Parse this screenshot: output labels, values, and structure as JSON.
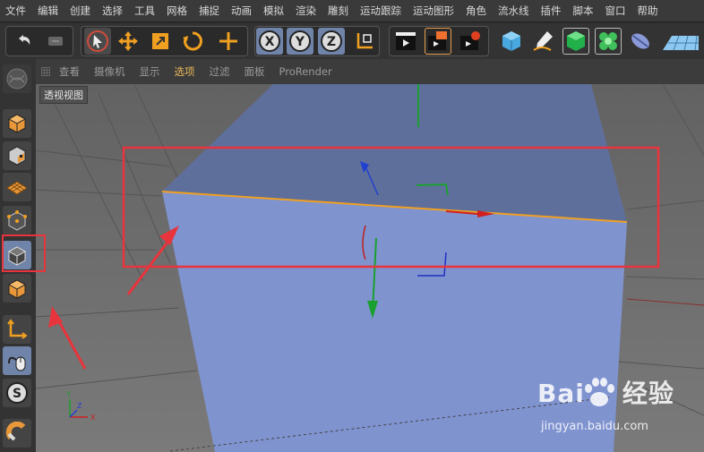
{
  "menubar": {
    "items": [
      "文件",
      "编辑",
      "创建",
      "选择",
      "工具",
      "网格",
      "捕捉",
      "动画",
      "模拟",
      "渲染",
      "雕刻",
      "运动跟踪",
      "运动图形",
      "角色",
      "流水线",
      "插件",
      "脚本",
      "窗口",
      "帮助"
    ]
  },
  "toolbar": {
    "buttons": [
      {
        "name": "undo-icon"
      },
      {
        "name": "redo-icon"
      },
      {
        "name": "select-icon"
      },
      {
        "name": "move-icon"
      },
      {
        "name": "scale-icon"
      },
      {
        "name": "rotate-icon"
      },
      {
        "name": "add-transform-icon"
      },
      {
        "name": "x-axis-icon",
        "label": "X"
      },
      {
        "name": "y-axis-icon",
        "label": "Y"
      },
      {
        "name": "z-axis-icon",
        "label": "Z"
      },
      {
        "name": "coordinate-system-icon"
      },
      {
        "name": "render-view-icon"
      },
      {
        "name": "render-picture-viewer-icon"
      },
      {
        "name": "render-settings-icon"
      },
      {
        "name": "cube-icon"
      },
      {
        "name": "pen-spline-icon"
      },
      {
        "name": "subdivision-icon"
      },
      {
        "name": "cloner-icon"
      },
      {
        "name": "deformer-icon"
      },
      {
        "name": "floor-icon"
      }
    ]
  },
  "left_toolbar": {
    "buttons": [
      {
        "name": "make-editable-icon"
      },
      {
        "name": "model-mode-icon"
      },
      {
        "name": "texture-mode-icon"
      },
      {
        "name": "workplane-mode-icon"
      },
      {
        "name": "point-mode-icon"
      },
      {
        "name": "edge-mode-icon",
        "active": true
      },
      {
        "name": "polygon-mode-icon"
      },
      {
        "name": "axis-mode-icon"
      },
      {
        "name": "tweak-mode-icon"
      },
      {
        "name": "snap-icon",
        "label": "S"
      },
      {
        "name": "magnet-icon"
      }
    ]
  },
  "viewport_header": {
    "menus": [
      "查看",
      "摄像机",
      "显示",
      "选项",
      "过滤",
      "面板",
      "ProRender"
    ],
    "active_index": 3
  },
  "viewport": {
    "label": "透视视图"
  },
  "axis_gizmo": {
    "y": "Y",
    "x": "X",
    "z": "Z"
  },
  "watermark": {
    "main": "Bai",
    "main2": "经验",
    "sub": "jingyan.baidu.com"
  },
  "colors": {
    "highlight_red": "#e8343c",
    "selected_edge": "#f0a020",
    "cube_top": "#5f6f9c",
    "cube_front": "#7f93cf"
  }
}
